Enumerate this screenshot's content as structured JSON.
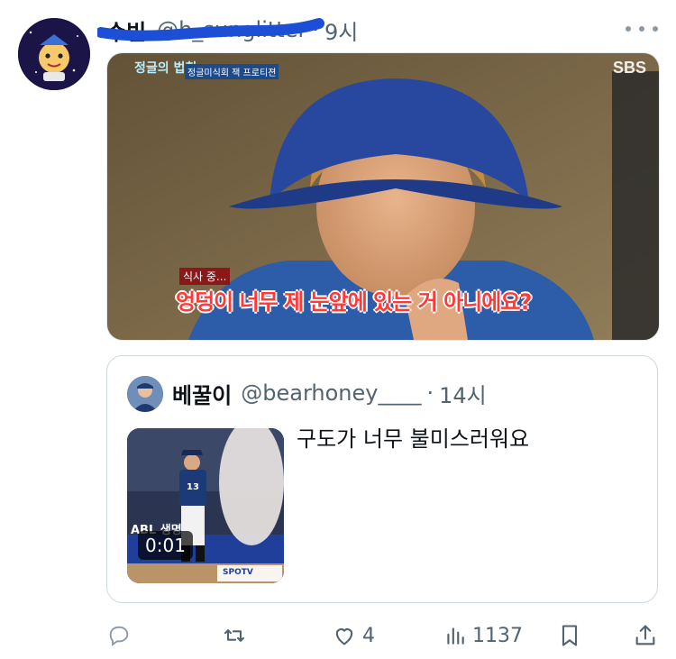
{
  "tweet": {
    "display_name": "수빈",
    "handle": "@h_sunglitter",
    "separator": "·",
    "time": "9시"
  },
  "media": {
    "broadcaster": "SBS",
    "show_logo": "정글의 법칙",
    "show_sub": "정글미식회 잭 프로티젼",
    "caption_small": "식사 중...",
    "caption_main": "엉덩이 너무 제 눈앞에 있는 거 아니에요?"
  },
  "quoted": {
    "display_name": "베꿀이",
    "handle": "@bearhoney____",
    "separator": "·",
    "time": "14시",
    "text": "구도가 너무 불미스러워요",
    "video_duration": "0:01",
    "player_number": "13",
    "banner_text": "ABL 생명",
    "channel": "SPOTV"
  },
  "actions": {
    "reply": {
      "icon": "reply-icon",
      "count": ""
    },
    "retweet": {
      "icon": "retweet-icon",
      "count": ""
    },
    "like": {
      "icon": "heart-icon",
      "count": "4"
    },
    "views": {
      "icon": "views-icon",
      "count": "1137"
    },
    "bookmark": {
      "icon": "bookmark-icon"
    },
    "share": {
      "icon": "share-icon"
    }
  },
  "colors": {
    "text_primary": "#0f1419",
    "text_secondary": "#536471",
    "border": "#cfd9de",
    "scribble": "#1d4fd6"
  }
}
